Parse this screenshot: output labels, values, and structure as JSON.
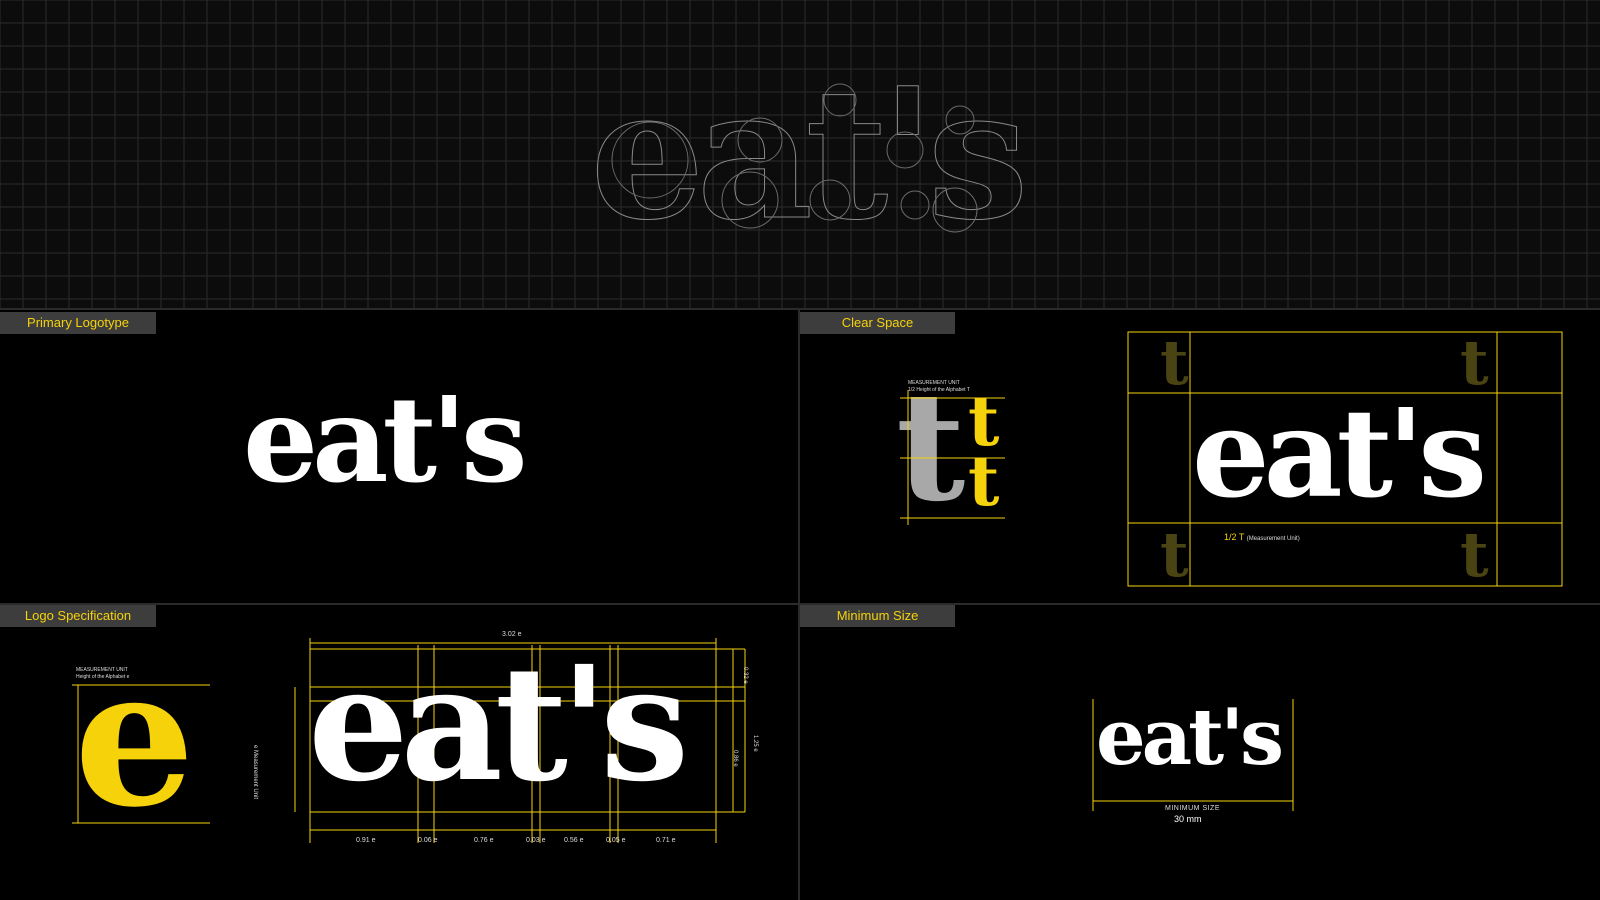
{
  "brand": {
    "wordmark": "eat's"
  },
  "colors": {
    "accent": "#f5d20a",
    "background": "#000000",
    "label_bg": "#3d3d3d",
    "grid_line": "#2b2b2b",
    "grey_t": "#a8a8a8"
  },
  "sections": {
    "primary": {
      "label": "Primary Logotype"
    },
    "clear_space": {
      "label": "Clear Space",
      "unit_title": "MEASUREMENT UNIT",
      "unit_desc": "1/2 Height of the Alphabet T",
      "t_glyph": "t",
      "half_t": "1/2 T",
      "half_t_note": "(Measurement Unit)"
    },
    "spec": {
      "label": "Logo Specification",
      "unit_title": "MEASUREMENT UNIT",
      "unit_desc": "Height of the Alphabet e",
      "e_glyph": "e",
      "width_label": "3.02 e",
      "side_label": "e Measurement Unit",
      "right_labels": [
        "0.32 e",
        "1.25 e",
        "0.86 e"
      ],
      "bottom_labels": [
        "0.91 e",
        "0.06 e",
        "0.76 e",
        "0.03 e",
        "0.56 e",
        "0.05 e",
        "0.71 e"
      ]
    },
    "minimum": {
      "label": "Minimum Size",
      "caption": "MINIMUM SIZE",
      "size": "30 mm"
    }
  }
}
